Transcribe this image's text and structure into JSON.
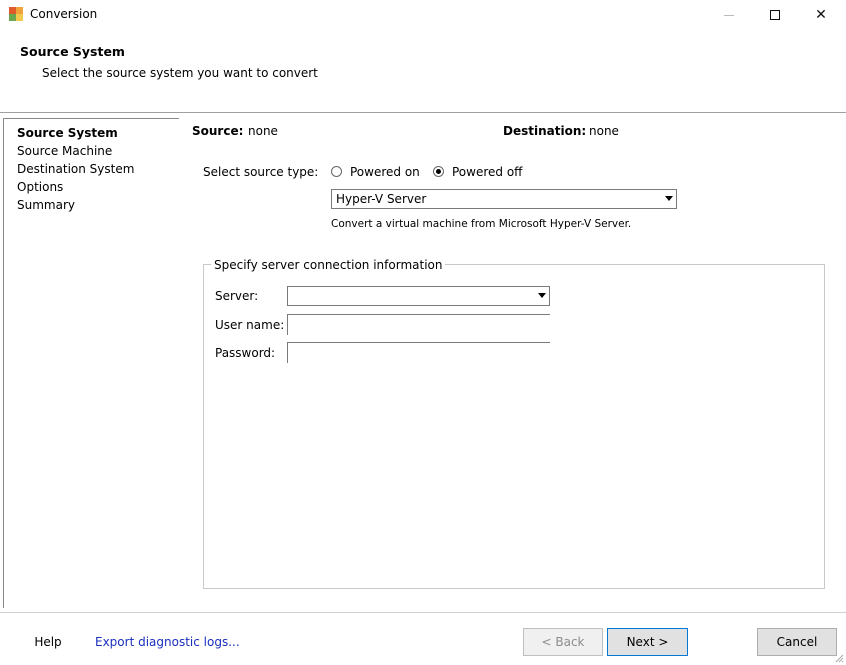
{
  "window": {
    "title": "Conversion",
    "minimize_icon": "minimize-icon",
    "maximize_icon": "maximize-icon",
    "close_glyph": "✕"
  },
  "header": {
    "title": "Source System",
    "subtitle": "Select the source system you want to convert"
  },
  "nav": {
    "items": [
      {
        "label": "Source System",
        "active": true
      },
      {
        "label": "Source Machine",
        "active": false
      },
      {
        "label": "Destination System",
        "active": false
      },
      {
        "label": "Options",
        "active": false
      },
      {
        "label": "Summary",
        "active": false
      }
    ]
  },
  "summary": {
    "source_label": "Source:",
    "source_value": "none",
    "destination_label": "Destination:",
    "destination_value": "none"
  },
  "source_type": {
    "label": "Select source type:",
    "options": [
      {
        "label": "Powered on",
        "selected": false
      },
      {
        "label": "Powered off",
        "selected": true
      }
    ],
    "dropdown_value": "Hyper-V Server",
    "description": "Convert a virtual machine from Microsoft Hyper-V Server."
  },
  "connection": {
    "group_title": "Specify server connection information",
    "server_label": "Server:",
    "server_value": "",
    "username_label": "User name:",
    "username_value": "",
    "password_label": "Password:",
    "password_value": ""
  },
  "footer": {
    "help_label": "Help",
    "export_label": "Export diagnostic logs...",
    "back_label": "< Back",
    "next_label": "Next >",
    "cancel_label": "Cancel"
  },
  "colors": {
    "link": "#1a2fbf",
    "default_button_border": "#0078d7"
  }
}
